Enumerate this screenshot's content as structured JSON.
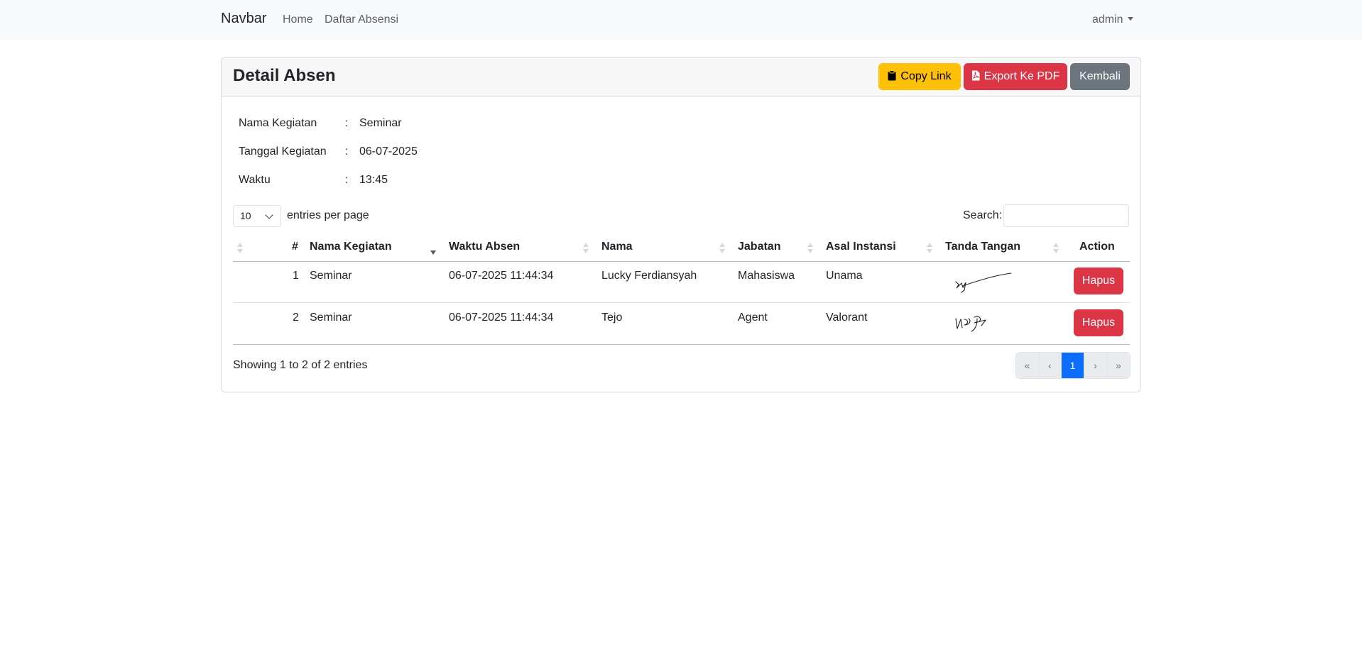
{
  "navbar": {
    "brand": "Navbar",
    "links": [
      "Home",
      "Daftar Absensi"
    ],
    "user": "admin"
  },
  "card": {
    "title": "Detail Absen",
    "buttons": {
      "copy": "Copy Link",
      "export": "Export Ke PDF",
      "back": "Kembali"
    }
  },
  "info": [
    {
      "label": "Nama Kegiatan",
      "value": "Seminar"
    },
    {
      "label": "Tanggal Kegiatan",
      "value": "06-07-2025"
    },
    {
      "label": "Waktu",
      "value": "13:45"
    }
  ],
  "colon": ":",
  "table_controls": {
    "page_length": "10",
    "length_text": "entries per page",
    "search_label": "Search:",
    "search_value": ""
  },
  "table": {
    "columns": [
      "#",
      "Nama Kegiatan",
      "Waktu Absen",
      "Nama",
      "Jabatan",
      "Asal Instansi",
      "Tanda Tangan",
      "Action"
    ],
    "rows": [
      {
        "no": "1",
        "kegiatan": "Seminar",
        "waktu": "06-07-2025 11:44:34",
        "nama": "Lucky Ferdiansyah",
        "jabatan": "Mahasiswa",
        "instansi": "Unama",
        "action": "Hapus"
      },
      {
        "no": "2",
        "kegiatan": "Seminar",
        "waktu": "06-07-2025 11:44:34",
        "nama": "Tejo",
        "jabatan": "Agent",
        "instansi": "Valorant",
        "action": "Hapus"
      }
    ]
  },
  "footer": {
    "showing": "Showing 1 to 2 of 2 entries",
    "pagination": [
      "«",
      "‹",
      "1",
      "›",
      "»"
    ]
  },
  "colors": {
    "navbar_bg": "#f8f9fa",
    "warning": "#ffc107",
    "danger": "#dc3545",
    "secondary": "#6c757d",
    "primary": "#0d6efd"
  },
  "icons": {
    "copy": "clipboard-icon",
    "export": "pdf-file-icon",
    "user_menu": "caret-down-icon",
    "sort": "sort-arrows-icon"
  }
}
